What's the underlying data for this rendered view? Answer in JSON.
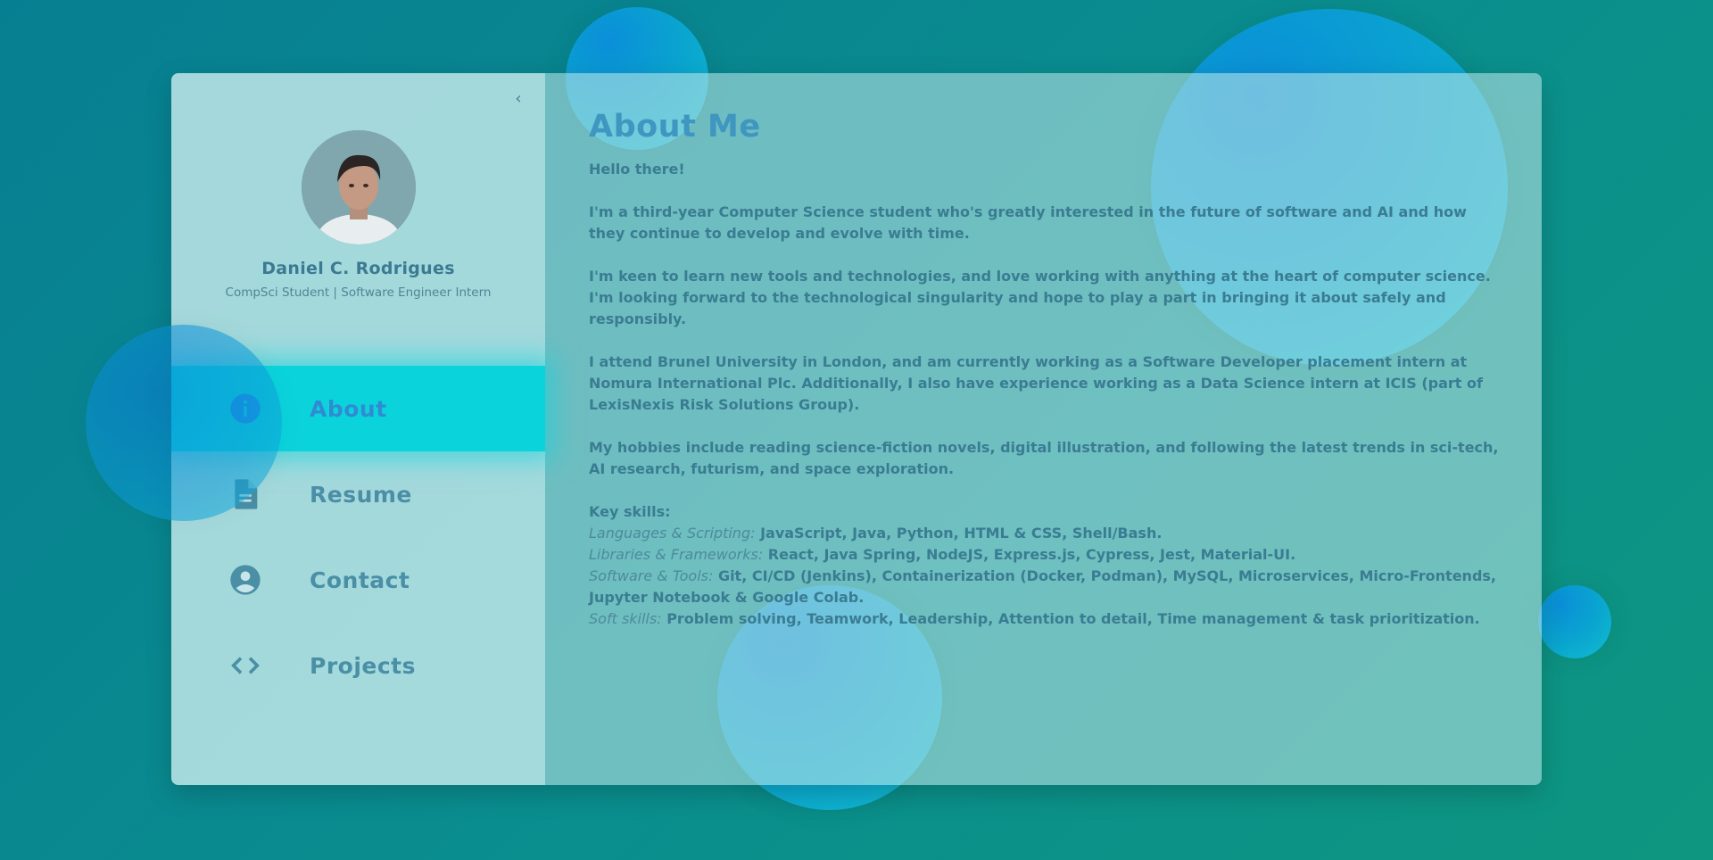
{
  "sidebar": {
    "collapse_icon": "chevron-left-icon",
    "collapse_glyph": "‹",
    "profile": {
      "name": "Daniel C. Rodrigues",
      "role": "CompSci Student | Software Engineer Intern"
    },
    "nav": [
      {
        "label": "About",
        "icon": "info-icon",
        "active": true
      },
      {
        "label": "Resume",
        "icon": "document-icon",
        "active": false
      },
      {
        "label": "Contact",
        "icon": "account-circle-icon",
        "active": false
      },
      {
        "label": "Projects",
        "icon": "code-icon",
        "active": false
      }
    ]
  },
  "main": {
    "title": "About Me",
    "paragraphs": [
      "Hello there!",
      "I'm a third-year Computer Science student who's greatly interested in the future of software and AI and how they continue to develop and evolve with time.",
      "I'm keen to learn new tools and technologies, and love working with anything at the heart of computer science. I'm looking forward to the technological singularity and hope to play a part in bringing it about safely and responsibly.",
      "I attend Brunel University in London, and am currently working as a Software Developer placement intern at Nomura International Plc. Additionally, I also have experience working as a Data Science intern at ICIS (part of LexisNexis Risk Solutions Group).",
      "My hobbies include reading science-fiction novels, digital illustration, and following the latest trends in sci-tech, AI research, futurism, and space exploration."
    ],
    "skills_heading": "Key skills:",
    "skills": [
      {
        "category": "Languages & Scripting:",
        "items": "JavaScript, Java, Python, HTML & CSS, Shell/Bash."
      },
      {
        "category": "Libraries & Frameworks:",
        "items": "React, Java Spring, NodeJS, Express.js, Cypress, Jest, Material-UI."
      },
      {
        "category": "Software & Tools:",
        "items": "Git, CI/CD (Jenkins), Containerization (Docker, Podman), MySQL, Microservices, Micro-Frontends, Jupyter Notebook & Google Colab."
      },
      {
        "category": "Soft skills:",
        "items": "Problem solving, Teamwork, Leadership, Attention to detail, Time management & task prioritization."
      }
    ]
  },
  "colors": {
    "accent": "#0bd3dc",
    "active_icon": "#1f8ee6",
    "text": "#3a7c92",
    "title": "#3f96c0"
  }
}
